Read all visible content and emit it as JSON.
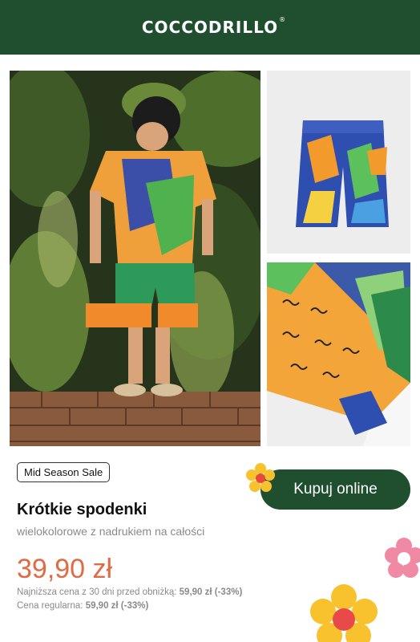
{
  "header": {
    "brand": "COCCODRILLO",
    "trademark": "®"
  },
  "product": {
    "badge": "Mid Season Sale",
    "name": "Krótkie spodenki",
    "description": "wielokolorowe z nadrukiem na całości",
    "price": "39,90 zł",
    "lowest_price_label": "Najniższa cena z 30 dni przed obniżką:",
    "lowest_price_value": "59,90 zł (-33%)",
    "regular_price_label": "Cena regularna:",
    "regular_price_value": "59,90 zł (-33%)"
  },
  "cta": {
    "label": "Kupuj online"
  },
  "colors": {
    "brand_green": "#1f4f2e",
    "price_orange": "#e06a44",
    "flower_yellow": "#f8c22e",
    "flower_pink": "#f08aa4"
  },
  "icons": [
    "flower-icon",
    "flower-pink-icon",
    "flower-yellow-icon"
  ]
}
